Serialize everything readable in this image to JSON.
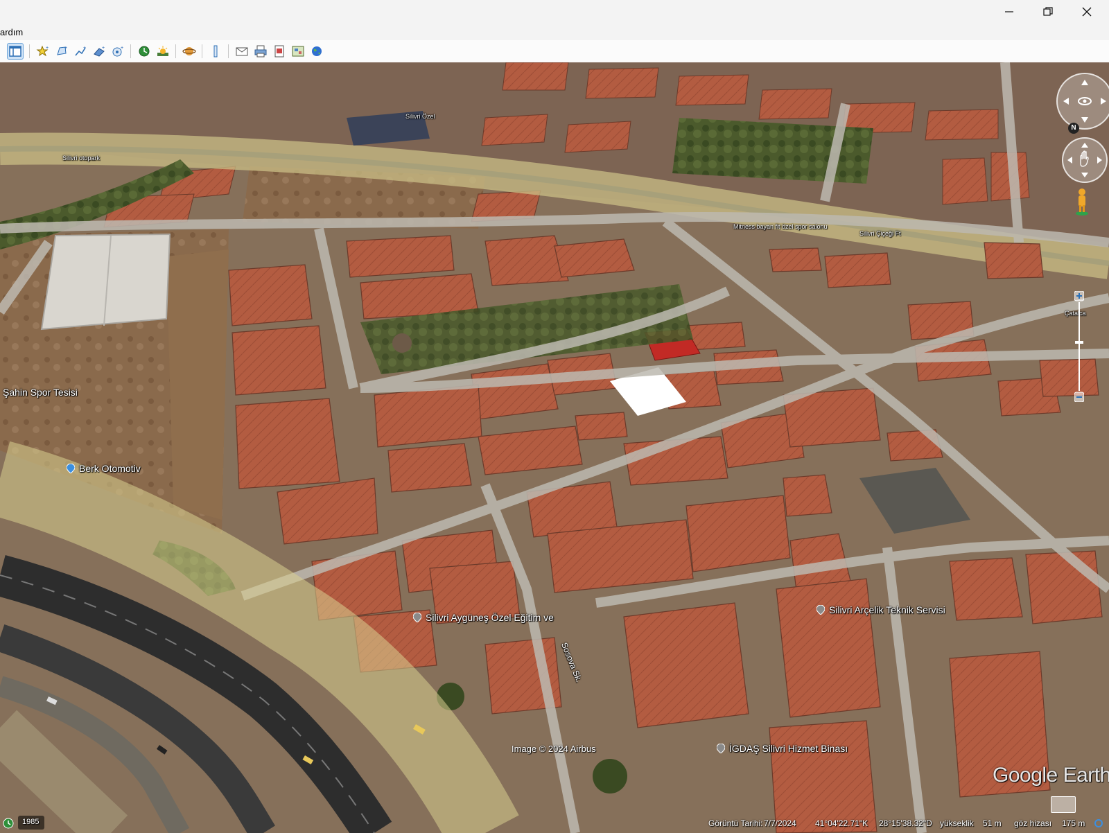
{
  "window": {
    "minimize_icon": "minimize-icon",
    "maximize_icon": "restore-icon",
    "close_icon": "close-icon"
  },
  "menu": {
    "items": [
      "ardım"
    ]
  },
  "toolbar": {
    "icons": [
      "sidebar-toggle-icon",
      "placemark-icon",
      "polygon-icon",
      "path-icon",
      "image-overlay-icon",
      "tour-icon",
      "historical-imagery-icon",
      "sunlight-icon",
      "planet-icon",
      "ruler-icon",
      "email-icon",
      "print-icon",
      "save-image-icon",
      "map-icon",
      "earth-icon"
    ]
  },
  "map": {
    "labels": {
      "sahin": "Şahin Spor Tesisi",
      "berk": "Berk Otomotiv",
      "aygunes": "Silivri Aygüneş Özel Eğitim ve",
      "street": "Sosova Sk.",
      "arcelik": "Silivri Arçelik Teknik Servisi",
      "igdas": "İGDAŞ Silivri Hizmet Binası",
      "fitness": "Mitness bayan fit özel spor salonu",
      "cicegi": "Silivri Çiçeği Ft",
      "catalca": "Çatalca",
      "ozel_label": "Silivri Özel",
      "top_left": "Silivri otopark"
    },
    "attribution": "Image © 2024 Airbus",
    "logo": "Google Earth"
  },
  "status": {
    "year": "1985",
    "date_label": "Görüntü Tarihi:",
    "date": "7/7/2024",
    "lat": "41°04'22.71\"K",
    "lon": "28°15'38.32\"D",
    "elev_label": "yükseklik",
    "elev": "51 m",
    "eye_label": "göz hizası",
    "eye": "175 m"
  },
  "colors": {
    "roof": "#b35c41",
    "road": "#b9b6ae",
    "highlight_road": "#d6cc86",
    "vegetation": "#4b5a2c",
    "accent_pin": "#3b8fe0"
  }
}
